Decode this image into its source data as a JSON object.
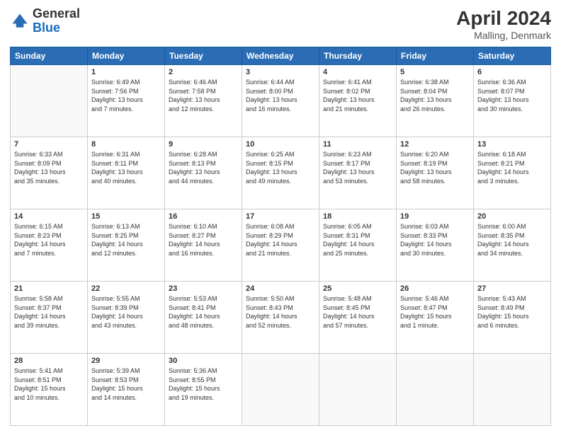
{
  "header": {
    "logo_general": "General",
    "logo_blue": "Blue",
    "title": "April 2024",
    "location": "Malling, Denmark"
  },
  "weekdays": [
    "Sunday",
    "Monday",
    "Tuesday",
    "Wednesday",
    "Thursday",
    "Friday",
    "Saturday"
  ],
  "weeks": [
    [
      {
        "day": "",
        "info": ""
      },
      {
        "day": "1",
        "info": "Sunrise: 6:49 AM\nSunset: 7:56 PM\nDaylight: 13 hours\nand 7 minutes."
      },
      {
        "day": "2",
        "info": "Sunrise: 6:46 AM\nSunset: 7:58 PM\nDaylight: 13 hours\nand 12 minutes."
      },
      {
        "day": "3",
        "info": "Sunrise: 6:44 AM\nSunset: 8:00 PM\nDaylight: 13 hours\nand 16 minutes."
      },
      {
        "day": "4",
        "info": "Sunrise: 6:41 AM\nSunset: 8:02 PM\nDaylight: 13 hours\nand 21 minutes."
      },
      {
        "day": "5",
        "info": "Sunrise: 6:38 AM\nSunset: 8:04 PM\nDaylight: 13 hours\nand 26 minutes."
      },
      {
        "day": "6",
        "info": "Sunrise: 6:36 AM\nSunset: 8:07 PM\nDaylight: 13 hours\nand 30 minutes."
      }
    ],
    [
      {
        "day": "7",
        "info": "Sunrise: 6:33 AM\nSunset: 8:09 PM\nDaylight: 13 hours\nand 35 minutes."
      },
      {
        "day": "8",
        "info": "Sunrise: 6:31 AM\nSunset: 8:11 PM\nDaylight: 13 hours\nand 40 minutes."
      },
      {
        "day": "9",
        "info": "Sunrise: 6:28 AM\nSunset: 8:13 PM\nDaylight: 13 hours\nand 44 minutes."
      },
      {
        "day": "10",
        "info": "Sunrise: 6:25 AM\nSunset: 8:15 PM\nDaylight: 13 hours\nand 49 minutes."
      },
      {
        "day": "11",
        "info": "Sunrise: 6:23 AM\nSunset: 8:17 PM\nDaylight: 13 hours\nand 53 minutes."
      },
      {
        "day": "12",
        "info": "Sunrise: 6:20 AM\nSunset: 8:19 PM\nDaylight: 13 hours\nand 58 minutes."
      },
      {
        "day": "13",
        "info": "Sunrise: 6:18 AM\nSunset: 8:21 PM\nDaylight: 14 hours\nand 3 minutes."
      }
    ],
    [
      {
        "day": "14",
        "info": "Sunrise: 6:15 AM\nSunset: 8:23 PM\nDaylight: 14 hours\nand 7 minutes."
      },
      {
        "day": "15",
        "info": "Sunrise: 6:13 AM\nSunset: 8:25 PM\nDaylight: 14 hours\nand 12 minutes."
      },
      {
        "day": "16",
        "info": "Sunrise: 6:10 AM\nSunset: 8:27 PM\nDaylight: 14 hours\nand 16 minutes."
      },
      {
        "day": "17",
        "info": "Sunrise: 6:08 AM\nSunset: 8:29 PM\nDaylight: 14 hours\nand 21 minutes."
      },
      {
        "day": "18",
        "info": "Sunrise: 6:05 AM\nSunset: 8:31 PM\nDaylight: 14 hours\nand 25 minutes."
      },
      {
        "day": "19",
        "info": "Sunrise: 6:03 AM\nSunset: 8:33 PM\nDaylight: 14 hours\nand 30 minutes."
      },
      {
        "day": "20",
        "info": "Sunrise: 6:00 AM\nSunset: 8:35 PM\nDaylight: 14 hours\nand 34 minutes."
      }
    ],
    [
      {
        "day": "21",
        "info": "Sunrise: 5:58 AM\nSunset: 8:37 PM\nDaylight: 14 hours\nand 39 minutes."
      },
      {
        "day": "22",
        "info": "Sunrise: 5:55 AM\nSunset: 8:39 PM\nDaylight: 14 hours\nand 43 minutes."
      },
      {
        "day": "23",
        "info": "Sunrise: 5:53 AM\nSunset: 8:41 PM\nDaylight: 14 hours\nand 48 minutes."
      },
      {
        "day": "24",
        "info": "Sunrise: 5:50 AM\nSunset: 8:43 PM\nDaylight: 14 hours\nand 52 minutes."
      },
      {
        "day": "25",
        "info": "Sunrise: 5:48 AM\nSunset: 8:45 PM\nDaylight: 14 hours\nand 57 minutes."
      },
      {
        "day": "26",
        "info": "Sunrise: 5:46 AM\nSunset: 8:47 PM\nDaylight: 15 hours\nand 1 minute."
      },
      {
        "day": "27",
        "info": "Sunrise: 5:43 AM\nSunset: 8:49 PM\nDaylight: 15 hours\nand 6 minutes."
      }
    ],
    [
      {
        "day": "28",
        "info": "Sunrise: 5:41 AM\nSunset: 8:51 PM\nDaylight: 15 hours\nand 10 minutes."
      },
      {
        "day": "29",
        "info": "Sunrise: 5:39 AM\nSunset: 8:53 PM\nDaylight: 15 hours\nand 14 minutes."
      },
      {
        "day": "30",
        "info": "Sunrise: 5:36 AM\nSunset: 8:55 PM\nDaylight: 15 hours\nand 19 minutes."
      },
      {
        "day": "",
        "info": ""
      },
      {
        "day": "",
        "info": ""
      },
      {
        "day": "",
        "info": ""
      },
      {
        "day": "",
        "info": ""
      }
    ]
  ]
}
